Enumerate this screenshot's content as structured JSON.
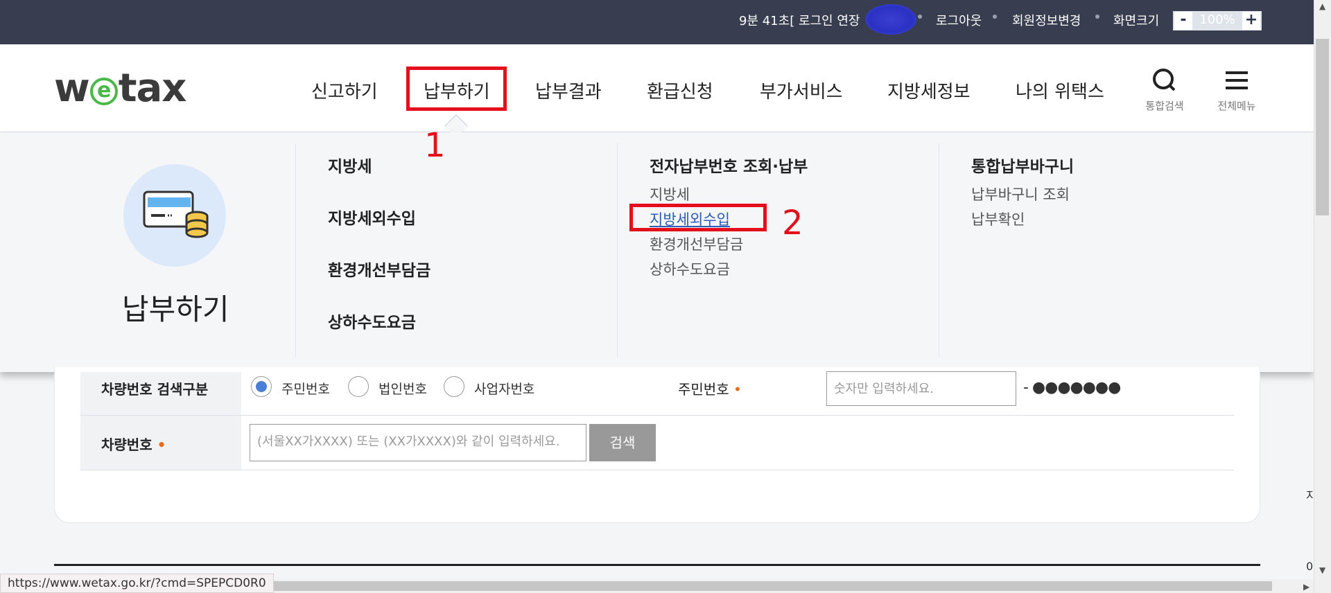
{
  "topbar": {
    "timer": "9분 41초[ 로그인 연장",
    "logout": "로그아웃",
    "member_info": "회원정보변경",
    "screen_size": "화면크기",
    "zoom_minus": "-",
    "zoom_value": "100%",
    "zoom_plus": "+"
  },
  "header": {
    "logo_left": "w",
    "logo_e": "e",
    "logo_right": "tax",
    "nav": [
      "신고하기",
      "납부하기",
      "납부결과",
      "환급신청",
      "부가서비스",
      "지방세정보",
      "나의 위택스"
    ],
    "search_label": "통합검색",
    "menu_label": "전체메뉴"
  },
  "annotations": {
    "one": "1",
    "two": "2"
  },
  "mega": {
    "title": "납부하기",
    "col1": [
      "지방세",
      "지방세외수입",
      "환경개선부담금",
      "상하수도요금"
    ],
    "col2_heading": "전자납부번호 조회·납부",
    "col2_items": [
      "지방세",
      "지방세외수입",
      "환경개선부담금",
      "상하수도요금"
    ],
    "col3_heading": "통합납부바구니",
    "col3_items": [
      "납부바구니 조회",
      "납부확인"
    ]
  },
  "form": {
    "search_type_label": "차량번호 검색구분",
    "radios": [
      "주민번호",
      "법인번호",
      "사업자번호"
    ],
    "resident_label": "주민번호",
    "resident_placeholder": "숫자만 입력하세요.",
    "resident_mask": "- ●●●●●●●",
    "vehicle_label": "차량번호",
    "vehicle_placeholder": "(서울XX가XXXX) 또는 (XX가XXXX)와 같이 입력하세요.",
    "search_button": "검색",
    "required_mark": "•"
  },
  "statusbar": {
    "url": "https://www.wetax.go.kr/?cmd=SPEPCD0R0"
  },
  "side_fragments": {
    "zi": "지",
    "zero": "0"
  },
  "colors": {
    "topbar": "#383d4f",
    "highlight": "#e3101c",
    "logo_green": "#4ab848",
    "link": "#2c5bb8"
  }
}
